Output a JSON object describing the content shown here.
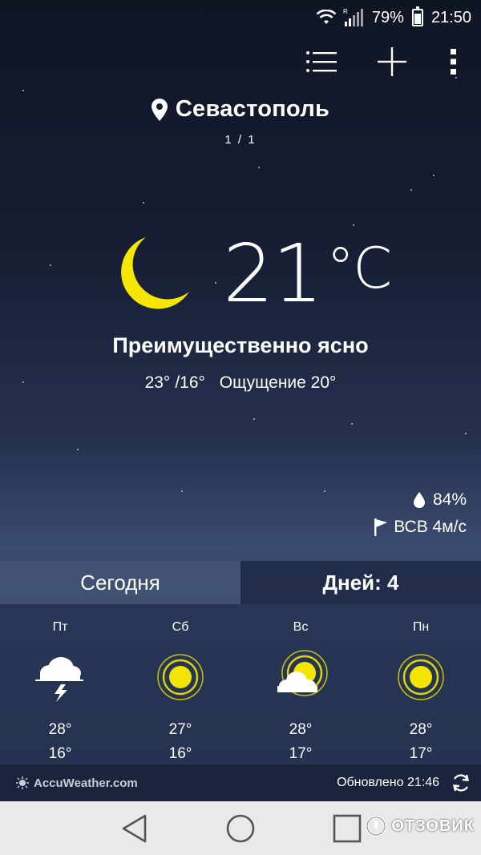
{
  "status_bar": {
    "battery": "79%",
    "time": "21:50",
    "icons": [
      "wifi-icon",
      "signal-icon",
      "battery-icon"
    ]
  },
  "toolbar": {
    "icons": [
      "list-icon",
      "plus-icon",
      "more-vertical-icon"
    ]
  },
  "location": {
    "city": "Севастополь",
    "page": "1 / 1"
  },
  "current": {
    "temperature": "21",
    "unit": "°C",
    "condition": "Преимущественно ясно",
    "high": "23°",
    "low": "/16°",
    "feels_like": "Ощущение 20°",
    "humidity": "84%",
    "wind": "ВСВ 4м/с",
    "icon": "moon-icon"
  },
  "tabs": {
    "today": "Сегодня",
    "days": "Дней: 4"
  },
  "forecast": [
    {
      "day": "Пт",
      "high": "28°",
      "low": "16°",
      "icon": "thunderstorm-icon"
    },
    {
      "day": "Сб",
      "high": "27°",
      "low": "16°",
      "icon": "sun-icon"
    },
    {
      "day": "Вс",
      "high": "28°",
      "low": "17°",
      "icon": "partly-cloudy-icon"
    },
    {
      "day": "Пн",
      "high": "28°",
      "low": "17°",
      "icon": "sun-icon"
    }
  ],
  "footer": {
    "brand": "AccuWeather.com",
    "updated": "Обновлено 21:46"
  },
  "watermark": "ОТЗОВИК",
  "colors": {
    "moon": "#f6e600",
    "sun": "#f4e400",
    "nav_bg": "#e9e9e9"
  }
}
